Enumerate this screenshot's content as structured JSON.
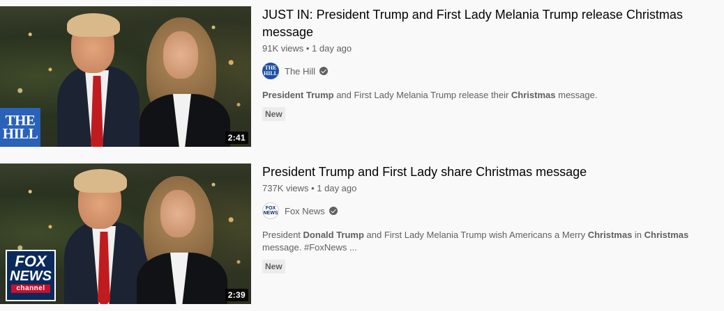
{
  "results": [
    {
      "title": "JUST IN: President Trump and First Lady Melania Trump release Christmas message",
      "views": "91K views",
      "age": "1 day ago",
      "channel": "The Hill",
      "channel_avatar_text": "THE HILL",
      "duration": "2:41",
      "thumb_logo_line1": "THE",
      "thumb_logo_line2": "HILL",
      "description": [
        {
          "text": "President Trump",
          "bold": true
        },
        {
          "text": " and First Lady Melania Trump release their ",
          "bold": false
        },
        {
          "text": "Christmas",
          "bold": true
        },
        {
          "text": " message.",
          "bold": false
        }
      ],
      "badge": "New",
      "verified_icon": "verified-check-icon"
    },
    {
      "title": "President Trump and First Lady share Christmas message",
      "views": "737K views",
      "age": "1 day ago",
      "channel": "Fox News",
      "channel_avatar_text": "FOX NEWS",
      "duration": "2:39",
      "thumb_logo_line1": "FOX",
      "thumb_logo_line2": "NEWS",
      "thumb_logo_line3": "channel",
      "description": [
        {
          "text": "President ",
          "bold": false
        },
        {
          "text": "Donald Trump",
          "bold": true
        },
        {
          "text": " and First Lady Melania Trump wish Americans a Merry ",
          "bold": false
        },
        {
          "text": "Christmas",
          "bold": true
        },
        {
          "text": " in ",
          "bold": false
        },
        {
          "text": "Christmas",
          "bold": true
        },
        {
          "text": " message. #FoxNews ...",
          "bold": false
        }
      ],
      "badge": "New",
      "verified_icon": "verified-check-icon"
    }
  ],
  "separator": " • "
}
